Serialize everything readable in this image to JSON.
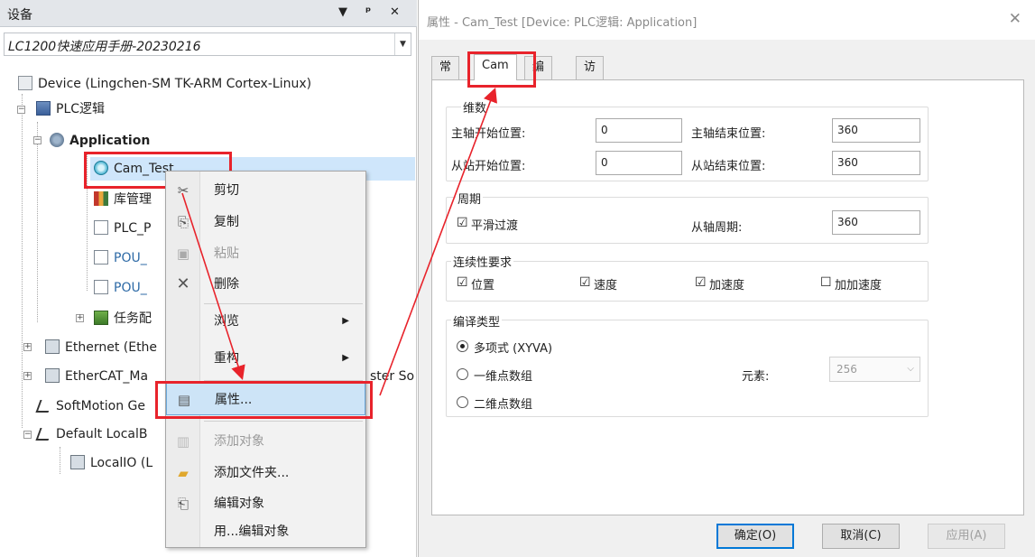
{
  "device_panel": {
    "title": "设备",
    "pin": "ᵖ",
    "close": "✕",
    "dropdown": "▼",
    "project": "LC1200快速应用手册-20230216",
    "tree": {
      "device": "Device (Lingchen-SM TK-ARM Cortex-Linux)",
      "plc_logic": "PLC逻辑",
      "application": "Application",
      "cam_test": "Cam_Test",
      "library_manager": "库管理",
      "plc_prg": "PLC_P",
      "pou1": "POU_",
      "pou2": "POU_",
      "task_config": "任务配",
      "ethernet": "Ethernet (Ethe",
      "ethercat": "EtherCAT_Ma",
      "ethercat_tail": "ster So",
      "softmotion": "SoftMotion Ge",
      "default_local": "Default LocalB",
      "localio": "LocalIO (L"
    }
  },
  "context_menu": {
    "items": [
      {
        "label": "剪切",
        "icon": "scissors-icon",
        "glyph": "✂",
        "enabled": true
      },
      {
        "label": "复制",
        "icon": "copy-icon",
        "glyph": "⎘",
        "enabled": true
      },
      {
        "label": "粘贴",
        "icon": "paste-icon",
        "glyph": "📋",
        "enabled": false
      },
      {
        "label": "删除",
        "icon": "delete-icon",
        "glyph": "✕",
        "enabled": true
      },
      {
        "label": "浏览",
        "icon": "",
        "glyph": "",
        "submenu": true,
        "enabled": true
      },
      {
        "label": "重构",
        "icon": "",
        "glyph": "",
        "submenu": true,
        "enabled": true
      },
      {
        "label": "属性...",
        "icon": "properties-icon",
        "glyph": "▤",
        "enabled": true,
        "highlighted": true
      },
      {
        "label": "添加对象",
        "icon": "add-object-icon",
        "glyph": "▥",
        "enabled": false
      },
      {
        "label": "添加文件夹...",
        "icon": "folder-icon",
        "glyph": "▰",
        "enabled": true
      },
      {
        "label": "编辑对象",
        "icon": "edit-object-icon",
        "glyph": "⎗",
        "enabled": true
      },
      {
        "label": "用...编辑对象",
        "icon": "",
        "glyph": "",
        "enabled": true
      }
    ],
    "submenu_arrow": "▶"
  },
  "dialog": {
    "title": "属性 - Cam_Test [Device: PLC逻辑: Application]",
    "close": "✕",
    "tabs": [
      "常规",
      "Cam",
      "编译",
      "访问控制"
    ],
    "active_tab": "Cam",
    "dimension": {
      "label": "维数",
      "master_start_label": "主轴开始位置:",
      "master_start_value": "0",
      "master_end_label": "主轴结束位置:",
      "master_end_value": "360",
      "slave_start_label": "从站开始位置:",
      "slave_start_value": "0",
      "slave_end_label": "从站结束位置:",
      "slave_end_value": "360"
    },
    "period": {
      "label": "周期",
      "smooth_label": "平滑过渡",
      "smooth_checked": true,
      "slave_period_label": "从轴周期:",
      "slave_period_value": "360"
    },
    "continuity": {
      "label": "连续性要求",
      "options": [
        {
          "label": "位置",
          "checked": true
        },
        {
          "label": "速度",
          "checked": true
        },
        {
          "label": "加速度",
          "checked": true
        },
        {
          "label": "加加速度",
          "checked": false
        }
      ]
    },
    "compile_type": {
      "label": "编译类型",
      "options": [
        {
          "label": "多项式 (XYVA)",
          "selected": true
        },
        {
          "label": "一维点数组",
          "selected": false
        },
        {
          "label": "二维点数组",
          "selected": false
        }
      ],
      "element_label": "元素:",
      "element_value": "256"
    },
    "buttons": {
      "ok": "确定(O)",
      "cancel": "取消(C)",
      "apply": "应用(A)"
    }
  },
  "check_mark": "☑",
  "check_empty": "☐",
  "select_arrow": "⌵",
  "colors": {
    "highlight_red": "#e8232b",
    "accent_blue": "#0078d7"
  }
}
